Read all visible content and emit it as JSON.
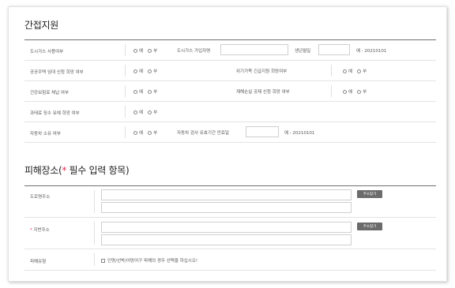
{
  "section1": {
    "title": "간접지원",
    "rows": [
      {
        "label": "도시가스 사용여부",
        "opt_yes": "예",
        "opt_no": "부",
        "extra_label": "도시가스 가입자명",
        "birth_label": "생년월일",
        "example": "예 : 20210101"
      },
      {
        "label": "공공주택 임대 신청 희망 여부",
        "opt_yes": "예",
        "opt_no": "부",
        "right_label": "위기가족 긴급지원 희망여부",
        "right_yes": "예",
        "right_no": "부"
      },
      {
        "label": "건강보험료 체납 여부",
        "opt_yes": "예",
        "opt_no": "부",
        "right_label": "재해손실 공제 신청 희망 여부",
        "right_yes": "예",
        "right_no": "부"
      },
      {
        "label": "과태료 징수 유예 희망 여부",
        "opt_yes": "예",
        "opt_no": "부"
      },
      {
        "label": "자동차 소유 여부",
        "opt_yes": "예",
        "opt_no": "부",
        "extra_label": "자동차 검사 유효기간 만료일",
        "example": "예 : 20210101"
      }
    ]
  },
  "section2": {
    "title_prefix": "피해장소(",
    "star": "*",
    "title_suffix": " 필수 입력 항목)",
    "road_label": "도로명주소",
    "lot_star": "*",
    "lot_label": "지번주소",
    "search_button": "주소찾기",
    "type_label": "피해유형",
    "type_text": "인명/선박/어망어구 피해의 경우 선택을 하십시오!"
  },
  "colors": {
    "required": "#e2264d",
    "button_bg": "#6b6b6b",
    "border_dark": "#6f6f6f"
  }
}
